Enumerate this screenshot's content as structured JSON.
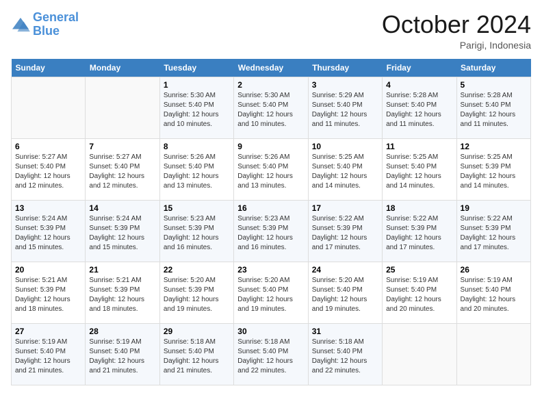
{
  "header": {
    "logo_line1": "General",
    "logo_line2": "Blue",
    "month": "October 2024",
    "location": "Parigi, Indonesia"
  },
  "weekdays": [
    "Sunday",
    "Monday",
    "Tuesday",
    "Wednesday",
    "Thursday",
    "Friday",
    "Saturday"
  ],
  "weeks": [
    [
      {
        "day": "",
        "sunrise": "",
        "sunset": "",
        "daylight": ""
      },
      {
        "day": "",
        "sunrise": "",
        "sunset": "",
        "daylight": ""
      },
      {
        "day": "1",
        "sunrise": "Sunrise: 5:30 AM",
        "sunset": "Sunset: 5:40 PM",
        "daylight": "Daylight: 12 hours and 10 minutes."
      },
      {
        "day": "2",
        "sunrise": "Sunrise: 5:30 AM",
        "sunset": "Sunset: 5:40 PM",
        "daylight": "Daylight: 12 hours and 10 minutes."
      },
      {
        "day": "3",
        "sunrise": "Sunrise: 5:29 AM",
        "sunset": "Sunset: 5:40 PM",
        "daylight": "Daylight: 12 hours and 11 minutes."
      },
      {
        "day": "4",
        "sunrise": "Sunrise: 5:28 AM",
        "sunset": "Sunset: 5:40 PM",
        "daylight": "Daylight: 12 hours and 11 minutes."
      },
      {
        "day": "5",
        "sunrise": "Sunrise: 5:28 AM",
        "sunset": "Sunset: 5:40 PM",
        "daylight": "Daylight: 12 hours and 11 minutes."
      }
    ],
    [
      {
        "day": "6",
        "sunrise": "Sunrise: 5:27 AM",
        "sunset": "Sunset: 5:40 PM",
        "daylight": "Daylight: 12 hours and 12 minutes."
      },
      {
        "day": "7",
        "sunrise": "Sunrise: 5:27 AM",
        "sunset": "Sunset: 5:40 PM",
        "daylight": "Daylight: 12 hours and 12 minutes."
      },
      {
        "day": "8",
        "sunrise": "Sunrise: 5:26 AM",
        "sunset": "Sunset: 5:40 PM",
        "daylight": "Daylight: 12 hours and 13 minutes."
      },
      {
        "day": "9",
        "sunrise": "Sunrise: 5:26 AM",
        "sunset": "Sunset: 5:40 PM",
        "daylight": "Daylight: 12 hours and 13 minutes."
      },
      {
        "day": "10",
        "sunrise": "Sunrise: 5:25 AM",
        "sunset": "Sunset: 5:40 PM",
        "daylight": "Daylight: 12 hours and 14 minutes."
      },
      {
        "day": "11",
        "sunrise": "Sunrise: 5:25 AM",
        "sunset": "Sunset: 5:40 PM",
        "daylight": "Daylight: 12 hours and 14 minutes."
      },
      {
        "day": "12",
        "sunrise": "Sunrise: 5:25 AM",
        "sunset": "Sunset: 5:39 PM",
        "daylight": "Daylight: 12 hours and 14 minutes."
      }
    ],
    [
      {
        "day": "13",
        "sunrise": "Sunrise: 5:24 AM",
        "sunset": "Sunset: 5:39 PM",
        "daylight": "Daylight: 12 hours and 15 minutes."
      },
      {
        "day": "14",
        "sunrise": "Sunrise: 5:24 AM",
        "sunset": "Sunset: 5:39 PM",
        "daylight": "Daylight: 12 hours and 15 minutes."
      },
      {
        "day": "15",
        "sunrise": "Sunrise: 5:23 AM",
        "sunset": "Sunset: 5:39 PM",
        "daylight": "Daylight: 12 hours and 16 minutes."
      },
      {
        "day": "16",
        "sunrise": "Sunrise: 5:23 AM",
        "sunset": "Sunset: 5:39 PM",
        "daylight": "Daylight: 12 hours and 16 minutes."
      },
      {
        "day": "17",
        "sunrise": "Sunrise: 5:22 AM",
        "sunset": "Sunset: 5:39 PM",
        "daylight": "Daylight: 12 hours and 17 minutes."
      },
      {
        "day": "18",
        "sunrise": "Sunrise: 5:22 AM",
        "sunset": "Sunset: 5:39 PM",
        "daylight": "Daylight: 12 hours and 17 minutes."
      },
      {
        "day": "19",
        "sunrise": "Sunrise: 5:22 AM",
        "sunset": "Sunset: 5:39 PM",
        "daylight": "Daylight: 12 hours and 17 minutes."
      }
    ],
    [
      {
        "day": "20",
        "sunrise": "Sunrise: 5:21 AM",
        "sunset": "Sunset: 5:39 PM",
        "daylight": "Daylight: 12 hours and 18 minutes."
      },
      {
        "day": "21",
        "sunrise": "Sunrise: 5:21 AM",
        "sunset": "Sunset: 5:39 PM",
        "daylight": "Daylight: 12 hours and 18 minutes."
      },
      {
        "day": "22",
        "sunrise": "Sunrise: 5:20 AM",
        "sunset": "Sunset: 5:39 PM",
        "daylight": "Daylight: 12 hours and 19 minutes."
      },
      {
        "day": "23",
        "sunrise": "Sunrise: 5:20 AM",
        "sunset": "Sunset: 5:40 PM",
        "daylight": "Daylight: 12 hours and 19 minutes."
      },
      {
        "day": "24",
        "sunrise": "Sunrise: 5:20 AM",
        "sunset": "Sunset: 5:40 PM",
        "daylight": "Daylight: 12 hours and 19 minutes."
      },
      {
        "day": "25",
        "sunrise": "Sunrise: 5:19 AM",
        "sunset": "Sunset: 5:40 PM",
        "daylight": "Daylight: 12 hours and 20 minutes."
      },
      {
        "day": "26",
        "sunrise": "Sunrise: 5:19 AM",
        "sunset": "Sunset: 5:40 PM",
        "daylight": "Daylight: 12 hours and 20 minutes."
      }
    ],
    [
      {
        "day": "27",
        "sunrise": "Sunrise: 5:19 AM",
        "sunset": "Sunset: 5:40 PM",
        "daylight": "Daylight: 12 hours and 21 minutes."
      },
      {
        "day": "28",
        "sunrise": "Sunrise: 5:19 AM",
        "sunset": "Sunset: 5:40 PM",
        "daylight": "Daylight: 12 hours and 21 minutes."
      },
      {
        "day": "29",
        "sunrise": "Sunrise: 5:18 AM",
        "sunset": "Sunset: 5:40 PM",
        "daylight": "Daylight: 12 hours and 21 minutes."
      },
      {
        "day": "30",
        "sunrise": "Sunrise: 5:18 AM",
        "sunset": "Sunset: 5:40 PM",
        "daylight": "Daylight: 12 hours and 22 minutes."
      },
      {
        "day": "31",
        "sunrise": "Sunrise: 5:18 AM",
        "sunset": "Sunset: 5:40 PM",
        "daylight": "Daylight: 12 hours and 22 minutes."
      },
      {
        "day": "",
        "sunrise": "",
        "sunset": "",
        "daylight": ""
      },
      {
        "day": "",
        "sunrise": "",
        "sunset": "",
        "daylight": ""
      }
    ]
  ]
}
